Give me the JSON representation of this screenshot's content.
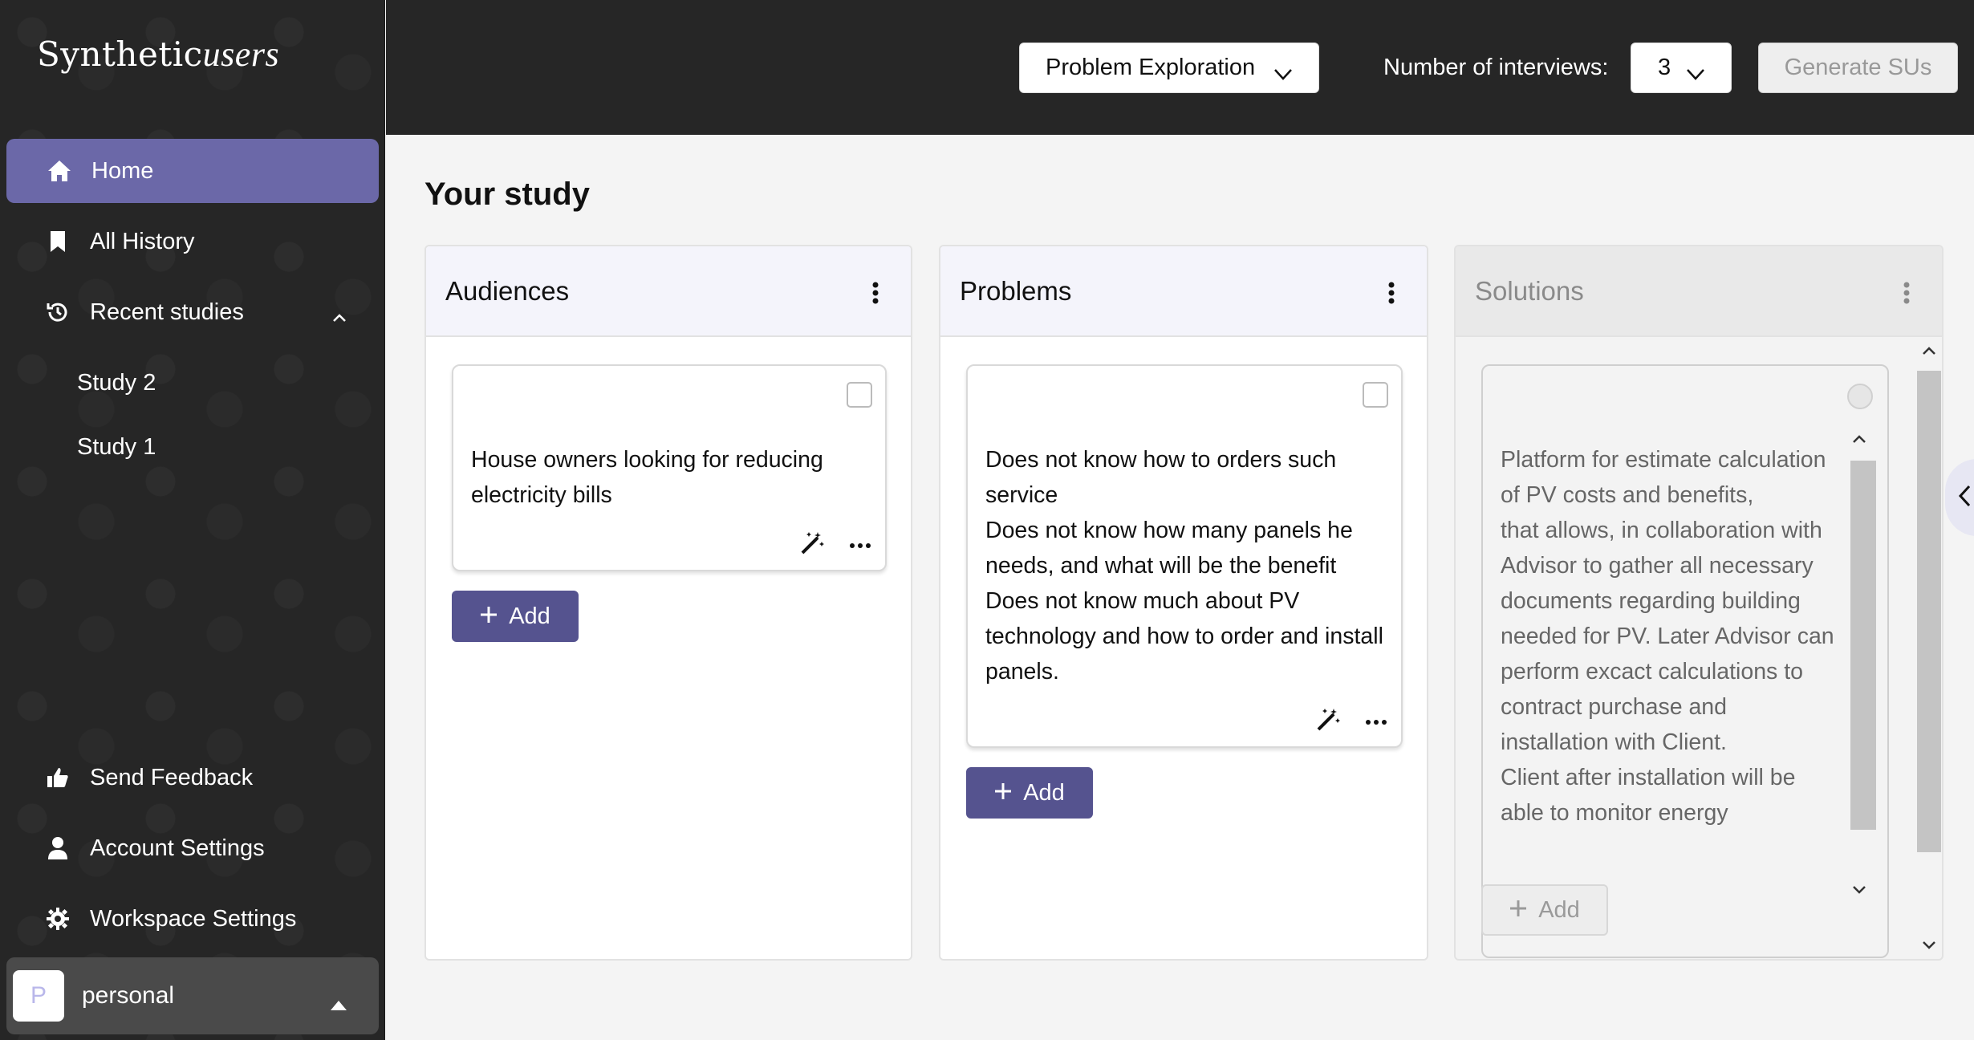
{
  "sidebar": {
    "logo_main": "Synthetic",
    "logo_script": "users",
    "items": [
      {
        "label": "Home",
        "icon": "home-icon"
      },
      {
        "label": "All History",
        "icon": "bookmark-icon"
      },
      {
        "label": "Recent studies",
        "icon": "history-icon"
      }
    ],
    "recent": [
      "Study 2",
      "Study 1"
    ],
    "bottom": [
      {
        "label": "Send Feedback",
        "icon": "thumbs-up-icon"
      },
      {
        "label": "Account Settings",
        "icon": "user-icon"
      },
      {
        "label": "Workspace Settings",
        "icon": "gear-icon"
      }
    ],
    "workspace": {
      "initial": "P",
      "name": "personal"
    }
  },
  "topbar": {
    "study_type": "Problem Exploration",
    "interviews_label": "Number of interviews:",
    "interviews_value": "3",
    "generate_label": "Generate SUs"
  },
  "main": {
    "title": "Your study",
    "columns": {
      "audiences": {
        "title": "Audiences",
        "card_text": "House owners looking for reducing electricity bills",
        "add_label": "Add"
      },
      "problems": {
        "title": "Problems",
        "card_text": "Does not know how to orders such service\nDoes not know how many panels he needs, and what will be the benefit\nDoes not know much about PV technology and how to order and install panels.",
        "add_label": "Add"
      },
      "solutions": {
        "title": "Solutions",
        "card_text": "Platform for estimate calculation of PV costs and benefits,\nthat allows, in collaboration with Advisor to gather all necessary documents regarding building needed for PV. Later Advisor can perform excact calculations to contract purchase and installation with Client.\nClient after installation will be able to monitor energy",
        "add_label": "Add"
      }
    }
  },
  "colors": {
    "accent": "#6b68a8",
    "button": "#55538f",
    "sidebar_bg": "#262626"
  }
}
